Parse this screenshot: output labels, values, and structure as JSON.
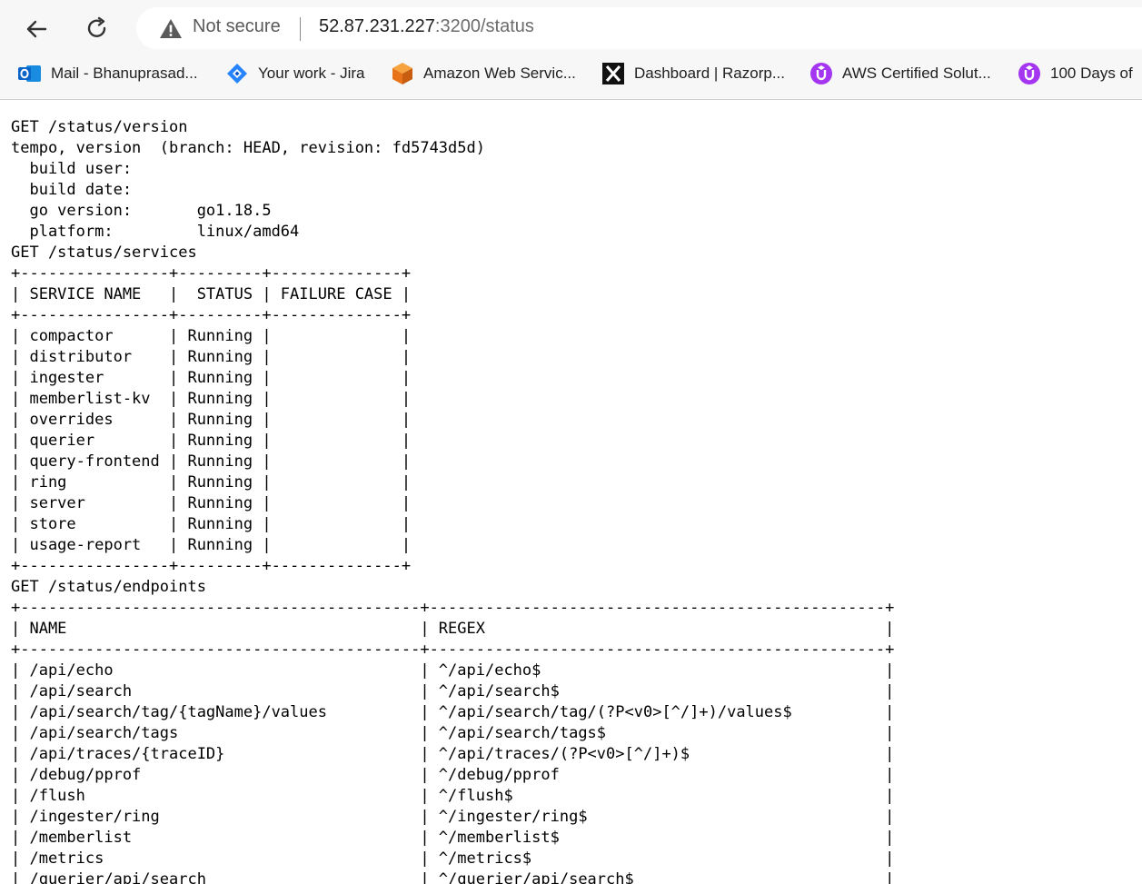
{
  "browser": {
    "security_label": "Not secure",
    "url_host": "52.87.231.227",
    "url_rest": ":3200/status",
    "icons": {
      "back": "back-arrow-icon",
      "reload": "reload-icon",
      "warning": "warning-icon"
    },
    "bookmarks": [
      {
        "label": "Mail - Bhanuprasad...",
        "icon": "outlook-icon",
        "color": "#0a64c8"
      },
      {
        "label": "Your work - Jira",
        "icon": "jira-icon",
        "color": "#2684ff"
      },
      {
        "label": "Amazon Web Servic...",
        "icon": "aws-cube-icon",
        "color": "#f28a1e"
      },
      {
        "label": "Dashboard | Razorp...",
        "icon": "razorpay-icon",
        "color": "#111111"
      },
      {
        "label": "AWS Certified Solut...",
        "icon": "udemy-icon",
        "color": "#a435f0"
      },
      {
        "label": "100 Days of",
        "icon": "udemy-icon",
        "color": "#a435f0"
      }
    ]
  },
  "content": {
    "lines": [
      "GET /status/version",
      "tempo, version  (branch: HEAD, revision: fd5743d5d)",
      "  build user:",
      "  build date:",
      "  go version:       go1.18.5",
      "  platform:         linux/amd64",
      "GET /status/services",
      "+----------------+---------+--------------+",
      "| SERVICE NAME   |  STATUS | FAILURE CASE |",
      "+----------------+---------+--------------+",
      "| compactor      | Running |              |",
      "| distributor    | Running |              |",
      "| ingester       | Running |              |",
      "| memberlist-kv  | Running |              |",
      "| overrides      | Running |              |",
      "| querier        | Running |              |",
      "| query-frontend | Running |              |",
      "| ring           | Running |              |",
      "| server         | Running |              |",
      "| store          | Running |              |",
      "| usage-report   | Running |              |",
      "+----------------+---------+--------------+",
      "GET /status/endpoints",
      "+-------------------------------------------+-------------------------------------------------+",
      "| NAME                                      | REGEX                                           |",
      "+-------------------------------------------+-------------------------------------------------+",
      "| /api/echo                                 | ^/api/echo$                                     |",
      "| /api/search                               | ^/api/search$                                   |",
      "| /api/search/tag/{tagName}/values          | ^/api/search/tag/(?P<v0>[^/]+)/values$          |",
      "| /api/search/tags                          | ^/api/search/tags$                              |",
      "| /api/traces/{traceID}                     | ^/api/traces/(?P<v0>[^/]+)$                     |",
      "| /debug/pprof                              | ^/debug/pprof                                   |",
      "| /flush                                    | ^/flush$                                        |",
      "| /ingester/ring                            | ^/ingester/ring$                                |",
      "| /memberlist                               | ^/memberlist$                                   |",
      "| /metrics                                  | ^/metrics$                                      |",
      "| /querier/api/search                       | ^/querier/api/search$                           |"
    ]
  }
}
